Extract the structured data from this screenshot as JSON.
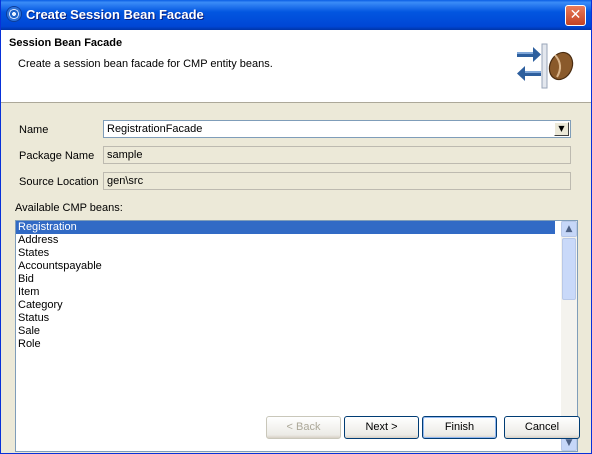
{
  "window": {
    "title": "Create Session Bean Facade",
    "close_label": "✕"
  },
  "banner": {
    "title": "Session Bean Facade",
    "description": "Create a session bean facade for CMP entity beans."
  },
  "form": {
    "name_label": "Name",
    "name_value": "RegistrationFacade",
    "package_label": "Package Name",
    "package_value": "sample",
    "source_label": "Source Location",
    "source_value": "gen\\src",
    "beans_label": "Available CMP beans:"
  },
  "beans": [
    "Registration",
    "Address",
    "States",
    "Accountspayable",
    "Bid",
    "Item",
    "Category",
    "Status",
    "Sale",
    "Role"
  ],
  "selected_bean": "Registration",
  "buttons": {
    "back": "< Back",
    "next": "Next >",
    "finish": "Finish",
    "cancel": "Cancel"
  },
  "icons": {
    "window": "wizard-app-icon",
    "banner": "session-bean-facade-icon",
    "dropdown": "chevron-down-icon",
    "scroll_up": "arrow-up-icon",
    "scroll_down": "arrow-down-icon"
  },
  "colors": {
    "titlebar": "#0054e3",
    "selection": "#316ac5",
    "close": "#d7502e",
    "dialog_bg": "#ece9d8"
  }
}
